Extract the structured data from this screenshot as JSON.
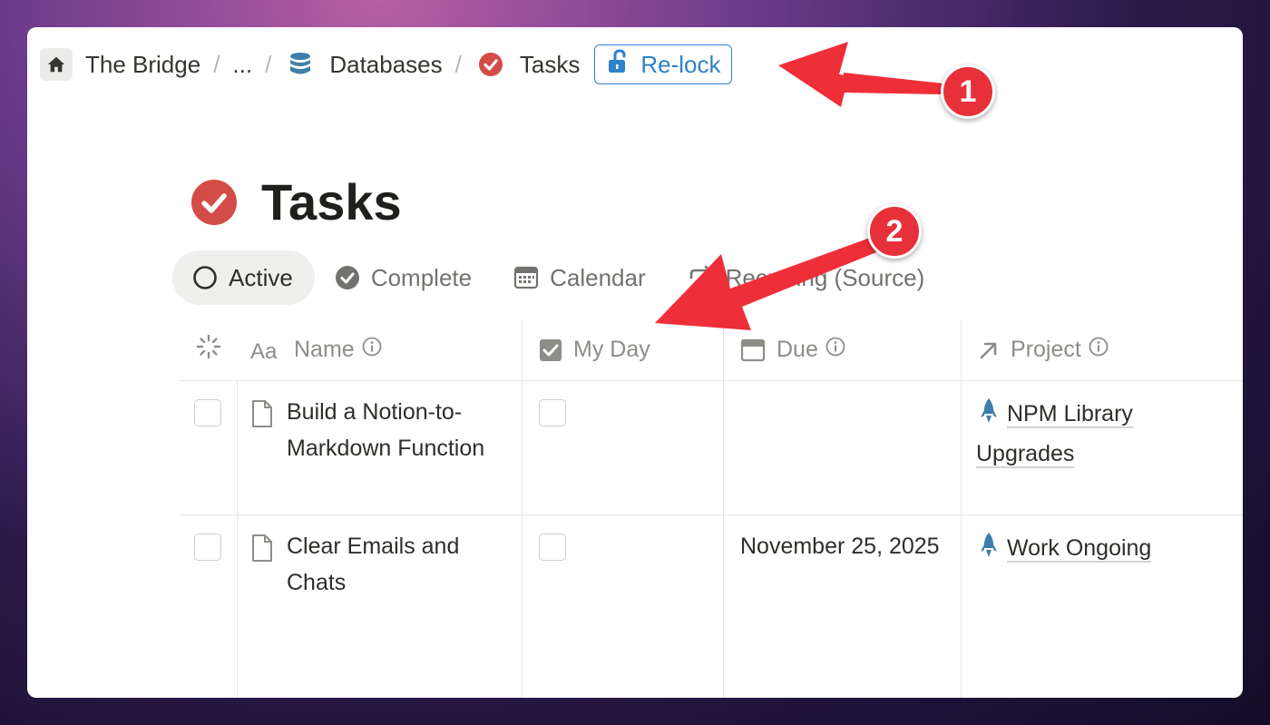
{
  "breadcrumb": {
    "home": "The Bridge",
    "ellipsis": "...",
    "databases": "Databases",
    "tasks": "Tasks",
    "relock": "Re-lock",
    "separator": "/"
  },
  "page": {
    "title": "Tasks"
  },
  "tabs": [
    {
      "label": "Active",
      "icon": "circle-outline-icon"
    },
    {
      "label": "Complete",
      "icon": "check-circle-icon"
    },
    {
      "label": "Calendar",
      "icon": "calendar-icon"
    },
    {
      "label": "Recurring (Source)",
      "icon": "repeat-icon"
    }
  ],
  "table": {
    "headers": {
      "name": "Name",
      "my_day": "My Day",
      "due": "Due",
      "project": "Project"
    },
    "rows": [
      {
        "name": "Build a Notion-to-Markdown Function",
        "due": "",
        "project": "NPM Library Upgrades"
      },
      {
        "name": "Clear Emails and Chats",
        "due": "November 25, 2025",
        "project": "Work Ongoing"
      }
    ]
  },
  "annotations": {
    "badge1": "1",
    "badge2": "2"
  },
  "colors": {
    "accent_blue": "#2e82c8",
    "task_red": "#d44c47",
    "annotation_red": "#e8303a",
    "rocket_blue": "#3d7fa8"
  }
}
